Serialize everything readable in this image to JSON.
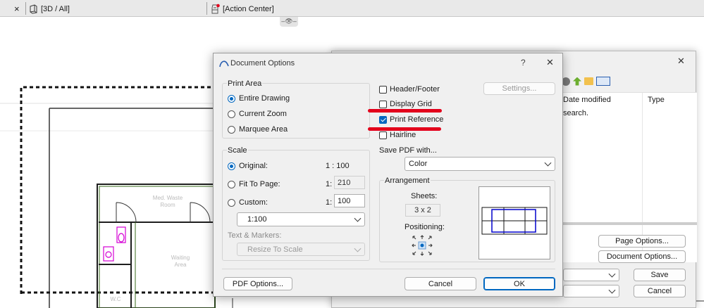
{
  "tabs": {
    "close_glyph": "×",
    "view_tab": "[3D / All]",
    "action_tab": "[Action Center]",
    "eye_glyph": "–👁–"
  },
  "plan": {
    "room_waste": "Med. Waste\nRoom",
    "room_waiting": "Waiting\nArea",
    "room_wc": "W.C"
  },
  "back_dialog": {
    "close_glyph": "✕",
    "col_date": "Date modified",
    "col_type": "Type",
    "search_text": "search.",
    "page_options": "Page Options...",
    "document_options": "Document Options...",
    "save": "Save",
    "cancel": "Cancel"
  },
  "dialog": {
    "title": "Document Options",
    "help_glyph": "?",
    "close_glyph": "✕",
    "print_area": {
      "title": "Print Area",
      "options": [
        "Entire Drawing",
        "Current Zoom",
        "Marquee Area"
      ],
      "selected": "Entire Drawing"
    },
    "scale": {
      "title": "Scale",
      "original_label": "Original:",
      "original_value": "1 : 100",
      "fit_label": "Fit To Page:",
      "fit_prefix": "1:",
      "fit_value": "210",
      "custom_label": "Custom:",
      "custom_prefix": "1:",
      "custom_value": "100",
      "custom_select": "1:100",
      "text_markers_label": "Text & Markers:",
      "text_markers_select": "Resize To Scale"
    },
    "checks": {
      "header_footer": "Header/Footer",
      "display_grid": "Display Grid",
      "print_reference": "Print Reference",
      "hairline": "Hairline",
      "settings_button": "Settings..."
    },
    "save_pdf_label": "Save PDF with...",
    "save_pdf_select": "Color",
    "arrangement": {
      "title": "Arrangement",
      "sheets_label": "Sheets:",
      "sheets_value": "3 x 2",
      "positioning_label": "Positioning:"
    },
    "pdf_options": "PDF Options...",
    "cancel": "Cancel",
    "ok": "OK"
  },
  "colors": {
    "accent": "#0067c0",
    "highlight_red": "#e3001b",
    "sheet_blue": "#0000cc"
  }
}
